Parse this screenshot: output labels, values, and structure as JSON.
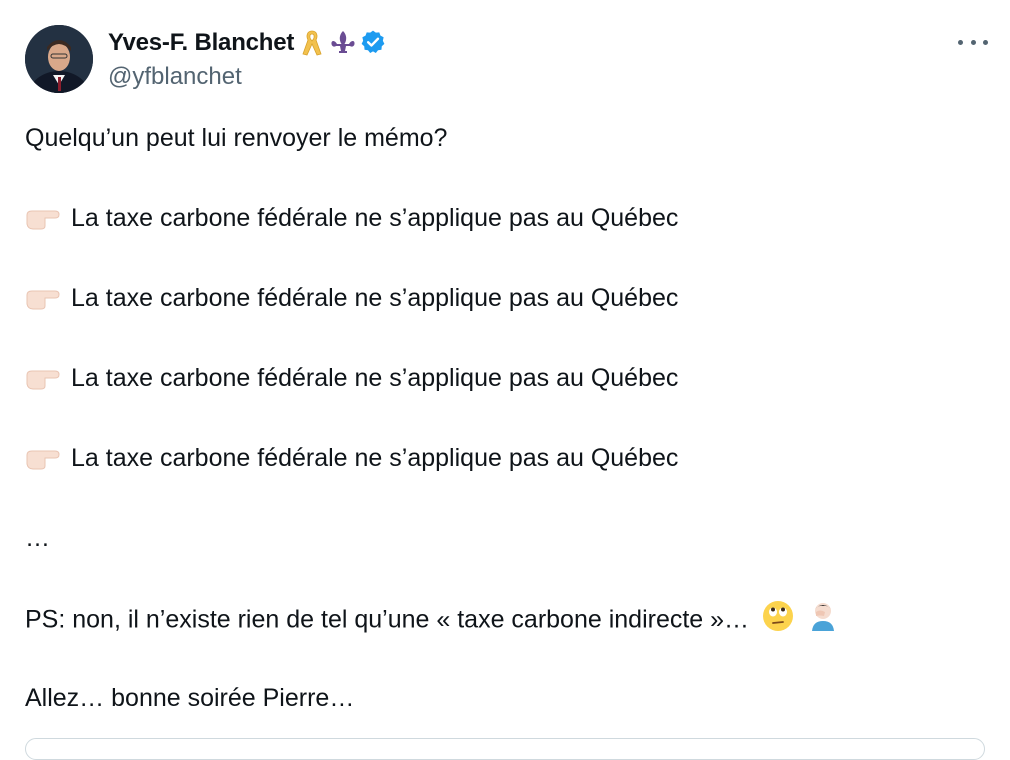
{
  "author": {
    "display_name": "Yves-F. Blanchet",
    "handle": "@yfblanchet",
    "badges": [
      "yellow-ribbon-icon",
      "fleur-de-lis-icon",
      "verified-badge-icon"
    ]
  },
  "tweet": {
    "intro": "Quelqu’un peut lui renvoyer le mémo?",
    "bullets": [
      "La taxe carbone fédérale ne s’applique pas au Québec",
      "La taxe carbone fédérale ne s’applique pas au Québec",
      "La taxe carbone fédérale ne s’applique pas au Québec",
      "La taxe carbone fédérale ne s’applique pas au Québec"
    ],
    "ellipsis": "…",
    "ps": "PS: non, il n’existe rien de tel qu’une « taxe carbone indirecte »…",
    "closing": "Allez… bonne soirée Pierre…"
  },
  "colors": {
    "text": "#0f1419",
    "secondary": "#536471",
    "verified": "#1d9bf0",
    "ribbon": "#f2c14e",
    "fleur": "#6a4c93"
  }
}
